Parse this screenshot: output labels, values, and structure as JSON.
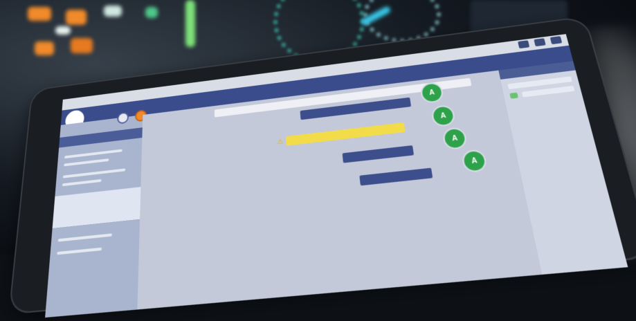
{
  "scene": {
    "colors": {
      "screen_accent": "#3a4c8c",
      "badge_green": "#2ea24a",
      "warning_yellow": "#f2dc4a",
      "panel_teal": "#3fd6c2",
      "panel_orange": "#f08a2a"
    }
  },
  "tablet_app": {
    "status_title": "",
    "header_title": "",
    "toolbar_icons": [
      "gear-icon",
      "globe-icon",
      "alert-icon"
    ],
    "steps": [
      {
        "label": "",
        "pill": "",
        "badge": "A",
        "warning": false
      },
      {
        "label": "",
        "pill": "",
        "badge": "A",
        "warning": true
      },
      {
        "label": "",
        "pill": "",
        "badge": "A",
        "warning": false
      },
      {
        "label": "",
        "pill": "",
        "badge": "A",
        "warning": false
      }
    ]
  }
}
